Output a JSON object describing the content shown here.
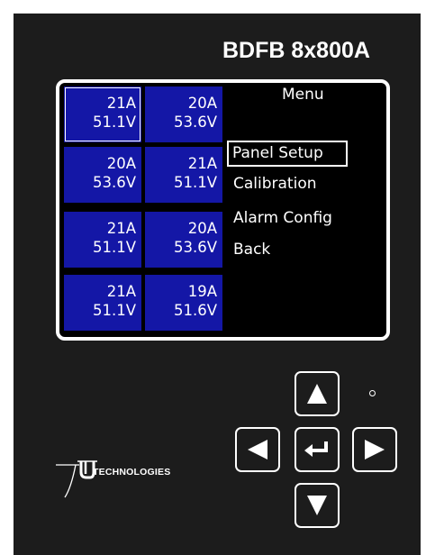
{
  "device": {
    "model": "BDFB 8x800A",
    "brand_logo_text": "TECHNOLOGIES"
  },
  "display": {
    "tiles": [
      {
        "current": "21A",
        "voltage": "51.1V"
      },
      {
        "current": "20A",
        "voltage": "53.6V"
      },
      {
        "current": "20A",
        "voltage": "53.6V"
      },
      {
        "current": "21A",
        "voltage": "51.1V"
      },
      {
        "current": "21A",
        "voltage": "51.1V"
      },
      {
        "current": "20A",
        "voltage": "53.6V"
      },
      {
        "current": "21A",
        "voltage": "51.1V"
      },
      {
        "current": "19A",
        "voltage": "51.6V"
      }
    ],
    "menu": {
      "title": "Menu",
      "items": [
        "Panel Setup",
        "Calibration",
        "Alarm Config",
        "Back"
      ],
      "selected": "Panel Setup"
    },
    "colors": {
      "tile": "#1417a6",
      "screen_bg": "#000000",
      "panel_bg": "#1c1c1c"
    }
  },
  "keypad": {
    "keys": [
      "up-arrow-icon",
      "left-arrow-icon",
      "enter-icon",
      "right-arrow-icon",
      "down-arrow-icon"
    ]
  }
}
